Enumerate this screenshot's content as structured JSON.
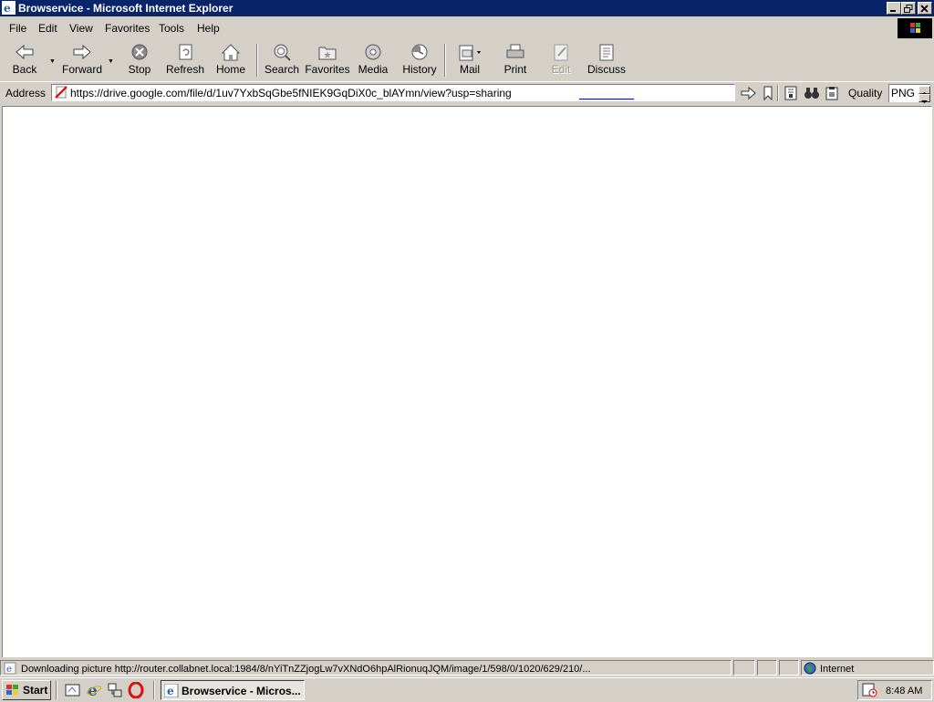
{
  "window": {
    "title": "Browservice - Microsoft Internet Explorer"
  },
  "menu": {
    "items": [
      "File",
      "Edit",
      "View",
      "Favorites",
      "Tools",
      "Help"
    ]
  },
  "toolbar": {
    "back": "Back",
    "forward": "Forward",
    "stop": "Stop",
    "refresh": "Refresh",
    "home": "Home",
    "search": "Search",
    "favorites": "Favorites",
    "media": "Media",
    "history": "History",
    "mail": "Mail",
    "print": "Print",
    "edit": "Edit",
    "discuss": "Discuss"
  },
  "address": {
    "label": "Address",
    "url": "https://drive.google.com/file/d/1uv7YxbSqGbe5fNIEK9GqDiX0c_blAYmn/view?usp=sharing",
    "quality_label": "Quality",
    "quality_value": "PNG"
  },
  "status": {
    "text": "Downloading picture http://router.collabnet.local:1984/8/nYiTnZZjogLw7vXNdO6hpAlRionuqJQM/image/1/598/0/1020/629/210/...",
    "zone": "Internet"
  },
  "taskbar": {
    "start": "Start",
    "task_label": "Browservice - Micros...",
    "clock": "8:48 AM"
  },
  "colors": {
    "titlebar": "#0a246a",
    "chrome": "#d4d0c8",
    "content": "#ffffff"
  }
}
